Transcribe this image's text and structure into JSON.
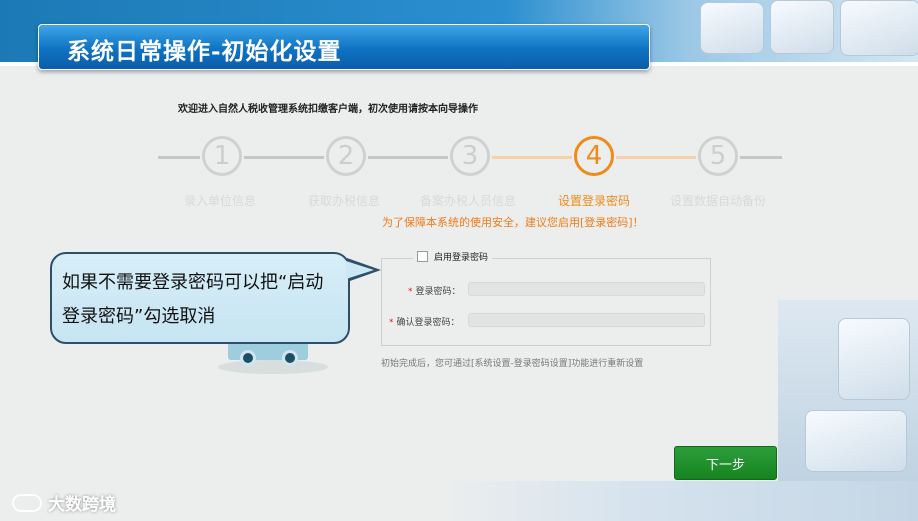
{
  "header": {
    "title": "系统日常操作-初始化设置"
  },
  "welcome_text": "欢迎进入自然人税收管理系统扣缴客户端，初次使用请按本向导操作",
  "steps": [
    {
      "number": "1",
      "label": "录入单位信息"
    },
    {
      "number": "2",
      "label": "获取办税信息"
    },
    {
      "number": "3",
      "label": "备案办税人员信息"
    },
    {
      "number": "4",
      "label": "设置登录密码"
    },
    {
      "number": "5",
      "label": "设置数据自动备份"
    }
  ],
  "active_step": 4,
  "notice": "为了保障本系统的使用安全，建议您启用[登录密码]！",
  "form": {
    "enable_password_label": "启用登录密码",
    "enable_password_checked": false,
    "password_label": "登录密码：",
    "password_value": "",
    "confirm_label": "确认登录密码：",
    "confirm_value": "",
    "required_mark": "*"
  },
  "hint": "初始完成后，您可通过[系统设置-登录密码设置]功能进行重新设置",
  "callout": {
    "text": "如果不需要登录密码可以把“启动登录密码”勾选取消"
  },
  "next_button": "下一步",
  "watermark": "大数跨境",
  "colors": {
    "accent": "#f08b1a",
    "primary_blue": "#1175c4",
    "button_green": "#1f8f2c"
  }
}
